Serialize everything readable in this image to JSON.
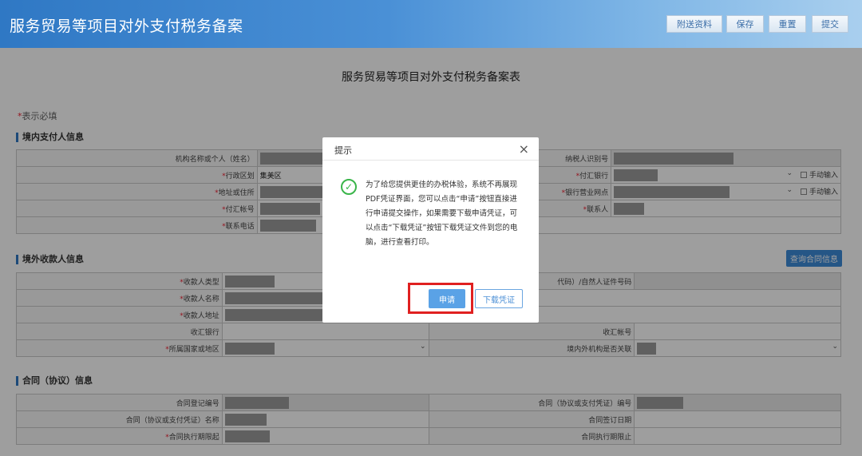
{
  "app": {
    "title": "服务贸易等项目对外支付税务备案",
    "toolbar": {
      "attach": "附送资料",
      "save": "保存",
      "reset": "重置",
      "submit": "提交"
    }
  },
  "form": {
    "page_title": "服务贸易等项目对外支付税务备案表",
    "required_note_star": "*",
    "required_note": "表示必填",
    "sections": {
      "payer": "境内支付人信息",
      "payee": "境外收款人信息",
      "contract": "合同（协议）信息"
    },
    "payer": {
      "org_name": "机构名称或个人（姓名）",
      "taxpayer_id": "纳税人识别号",
      "district": "行政区划",
      "district_value": "集美区",
      "remit_bank": "付汇银行",
      "manual_input": "手动输入",
      "address": "地址或住所",
      "bank_branch": "银行营业网点",
      "manual_input2": "手动输入",
      "remit_account": "付汇帐号",
      "contact": "联系人",
      "phone": "联系电话"
    },
    "payee": {
      "query_button": "查询合同信息",
      "type": "收款人类型",
      "id_code": "代码）/自然人证件号码",
      "name": "收款人名称",
      "address": "收款人地址",
      "bank": "收汇银行",
      "account": "收汇帐号",
      "country": "所属国家或地区",
      "related": "境内外机构是否关联"
    },
    "contract": {
      "reg_no": "合同登记编号",
      "contract_no": "合同（协议或支付凭证）编号",
      "name": "合同（协议或支付凭证）名称",
      "sign_date": "合同签订日期",
      "start": "合同执行期限起",
      "end": "合同执行期限止"
    }
  },
  "dialog": {
    "title": "提示",
    "close": "×",
    "icon": "check-circle-icon",
    "message": "为了给您提供更佳的办税体验，系统不再展现PDF凭证界面，您可以点击“申请”按钮直接进行申请提交操作，如果需要下载申请凭证，可以点击“下载凭证”按钮下载凭证文件到您的电脑，进行查看打印。",
    "apply": "申请",
    "download": "下载凭证"
  },
  "colors": {
    "header": "#2f78c4",
    "primary_button": "#5aa2e6",
    "highlight": "#e02020",
    "success": "#3ab54a"
  }
}
